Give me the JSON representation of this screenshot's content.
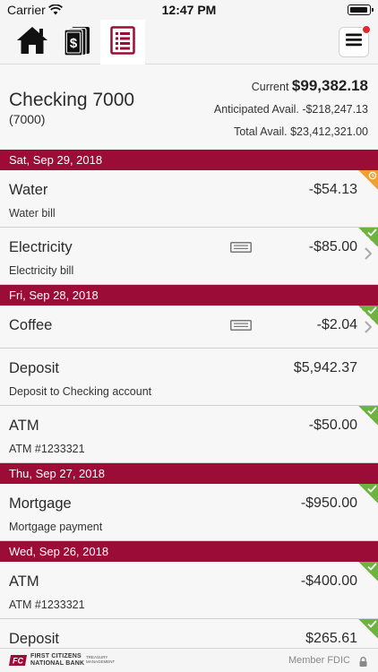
{
  "status_bar": {
    "carrier": "Carrier",
    "time": "12:47 PM"
  },
  "nav": {
    "tabs": [
      {
        "name": "home",
        "icon": "home-icon",
        "active": false
      },
      {
        "name": "accounts",
        "icon": "money-icon",
        "active": false
      },
      {
        "name": "register",
        "icon": "register-icon",
        "active": true
      }
    ],
    "menu_icon": "hamburger-menu-icon",
    "has_notification": true
  },
  "account": {
    "name": "Checking 7000",
    "number": "(7000)",
    "current_label": "Current",
    "current_value": "$99,382.18",
    "anticipated": "Anticipated Avail. -$218,247.13",
    "total": "Total Avail. $23,412,321.00"
  },
  "sections": [
    {
      "date": "Sat, Sep 29, 2018",
      "transactions": [
        {
          "name": "Water",
          "desc": "Water bill",
          "amount": "-$54.13",
          "status": "pending",
          "memo": false
        },
        {
          "name": "Electricity",
          "desc": "Electricity bill",
          "amount": "-$85.00",
          "status": "cleared",
          "memo": true
        }
      ]
    },
    {
      "date": "Fri, Sep 28, 2018",
      "transactions": [
        {
          "name": "Coffee",
          "desc": "",
          "amount": "-$2.04",
          "status": "cleared",
          "memo": true
        },
        {
          "name": "Deposit",
          "desc": "Deposit to Checking account",
          "amount": "$5,942.37",
          "status": "none",
          "memo": false
        },
        {
          "name": "ATM",
          "desc": "ATM #1233321",
          "amount": "-$50.00",
          "status": "cleared",
          "memo": false
        }
      ]
    },
    {
      "date": "Thu, Sep 27, 2018",
      "transactions": [
        {
          "name": "Mortgage",
          "desc": "Mortgage payment",
          "amount": "-$950.00",
          "status": "cleared",
          "memo": false
        }
      ]
    },
    {
      "date": "Wed, Sep 26, 2018",
      "transactions": [
        {
          "name": "ATM",
          "desc": "ATM #1233321",
          "amount": "-$400.00",
          "status": "cleared",
          "memo": false
        },
        {
          "name": "Deposit",
          "desc": "",
          "amount": "$265.61",
          "status": "cleared",
          "memo": false
        }
      ]
    }
  ],
  "footer": {
    "bank_name_line1": "FIRST CITIZENS",
    "bank_name_line2": "NATIONAL BANK",
    "tm_line1": "TREASURY",
    "tm_line2": "MANAGEMENT",
    "fdic": "Member FDIC"
  },
  "colors": {
    "brand": "#9b0d36",
    "cleared": "#6db33f",
    "pending": "#f0a030",
    "notification": "#e0282e"
  }
}
